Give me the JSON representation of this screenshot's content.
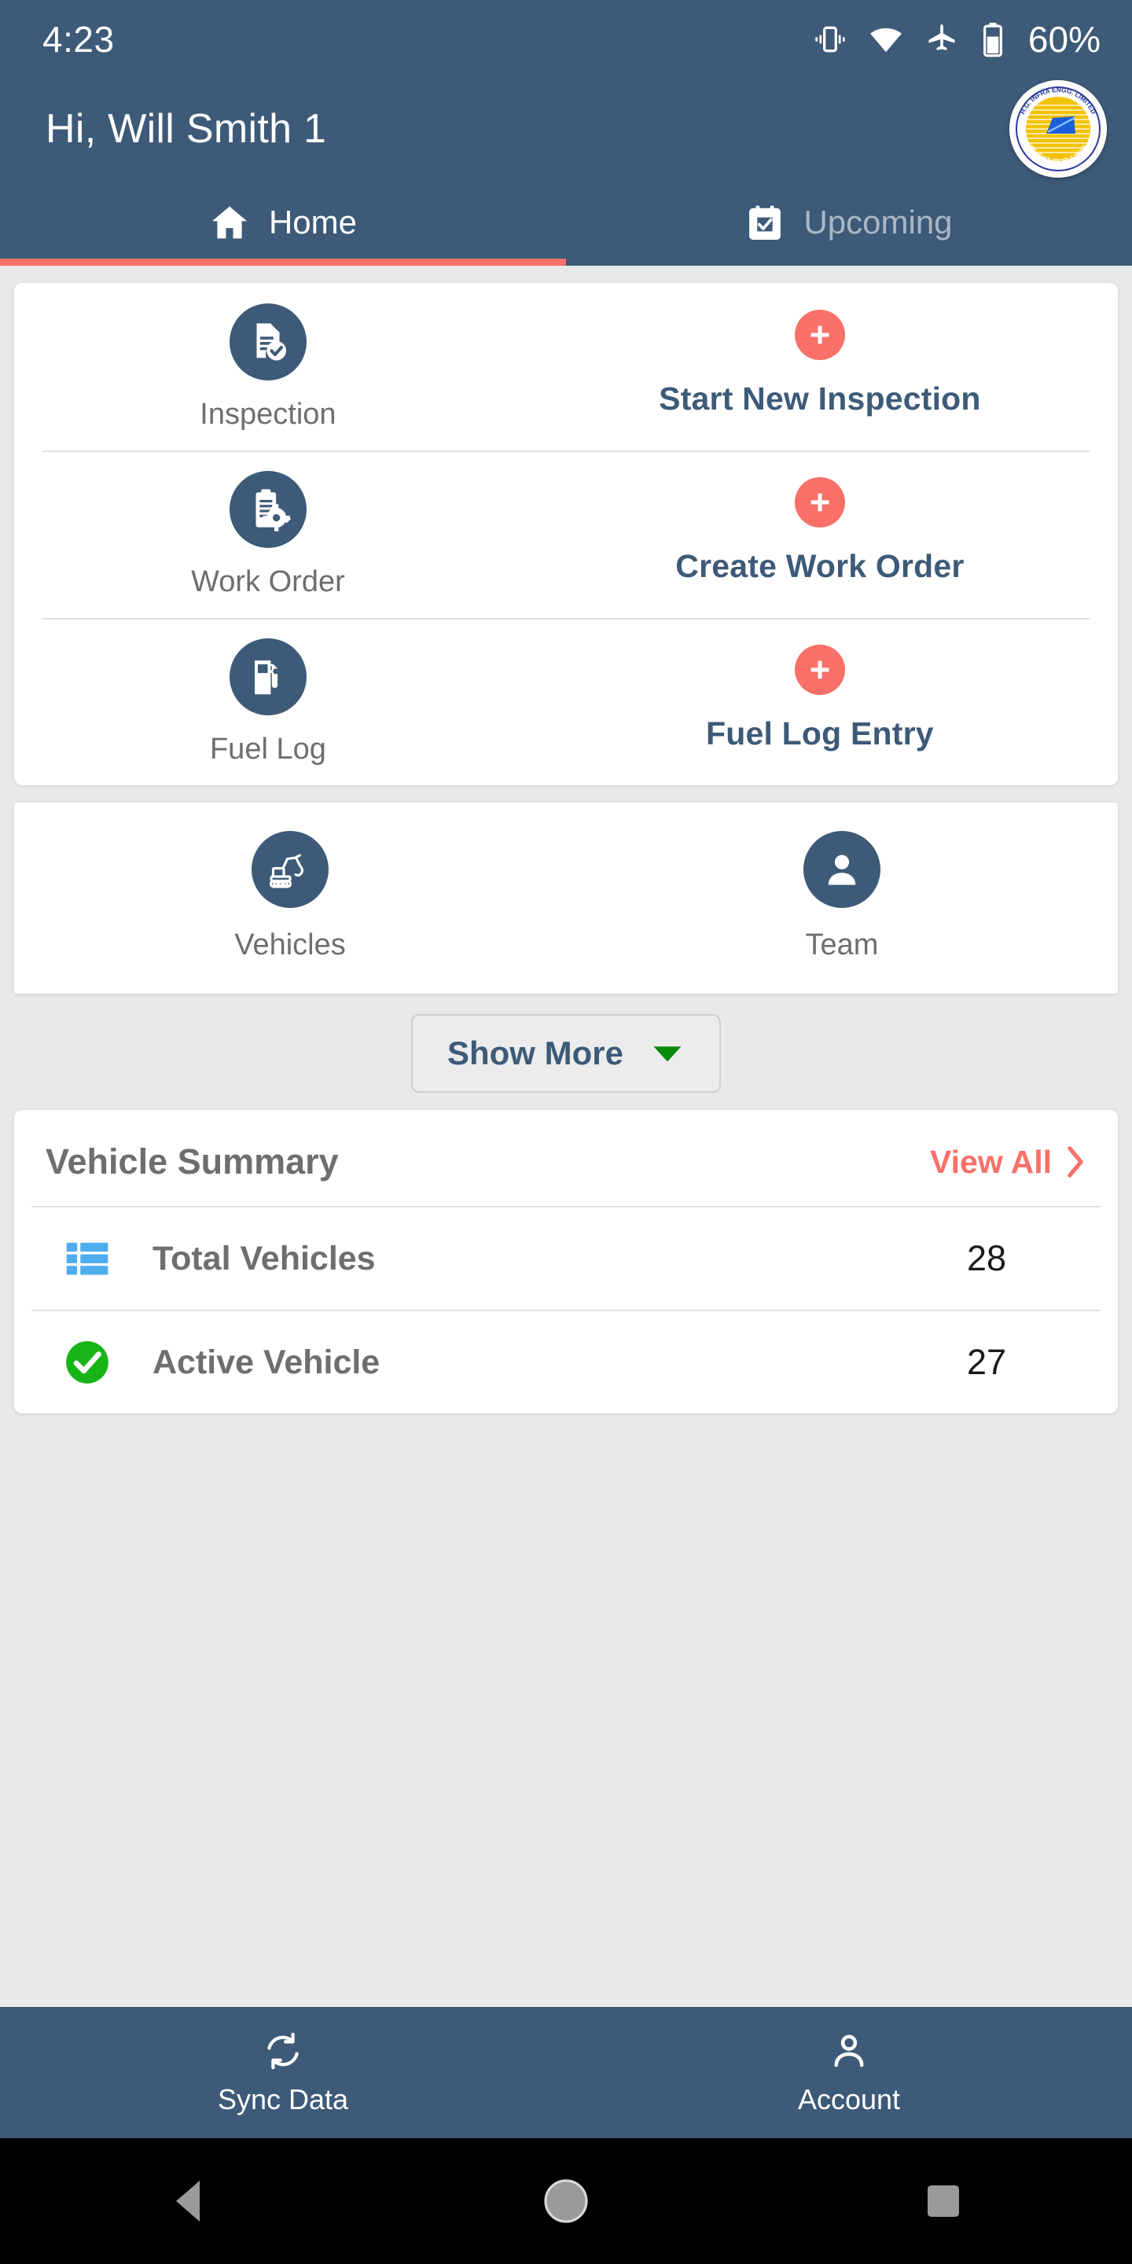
{
  "statusbar": {
    "time": "4:23",
    "battery_percent": "60%",
    "icons": [
      "vibrate-icon",
      "wifi-icon",
      "airplane-icon",
      "battery-icon"
    ]
  },
  "header": {
    "greeting": "Hi, Will Smith 1",
    "logo": {
      "name": "hg-infra-logo",
      "top_text": "H.G. INFRA ENGG. LIMITED",
      "bottom_text": "WE MAKE PEOPLE MOVE"
    },
    "background_color": "#3D5A78",
    "accent_color": "#F97068"
  },
  "tabs": [
    {
      "label": "Home",
      "icon": "home-icon",
      "active": true
    },
    {
      "label": "Upcoming",
      "icon": "calendar-check-icon",
      "active": false
    }
  ],
  "actions": [
    {
      "entity_label": "Inspection",
      "entity_icon": "document-check-icon",
      "action_label": "Start New Inspection",
      "action_icon": "plus-icon"
    },
    {
      "entity_label": "Work Order",
      "entity_icon": "clipboard-gear-icon",
      "action_label": "Create Work Order",
      "action_icon": "plus-icon"
    },
    {
      "entity_label": "Fuel Log",
      "entity_icon": "fuel-pump-icon",
      "action_label": "Fuel Log Entry",
      "action_icon": "plus-icon"
    }
  ],
  "tiles": [
    {
      "label": "Vehicles",
      "icon": "excavator-icon"
    },
    {
      "label": "Team",
      "icon": "person-icon"
    }
  ],
  "show_more": {
    "label": "Show More",
    "icon": "chevron-down-icon",
    "icon_color": "#0A8A0A"
  },
  "vehicle_summary": {
    "title": "Vehicle Summary",
    "view_all_label": "View All",
    "view_all_icon": "chevron-right-icon",
    "rows": [
      {
        "label": "Total Vehicles",
        "value": "28",
        "icon": "list-grid-icon",
        "icon_color": "#4FADEF"
      },
      {
        "label": "Active Vehicle",
        "value": "27",
        "icon": "check-circle-icon",
        "icon_color": "#17B417"
      }
    ]
  },
  "bottom_nav": [
    {
      "label": "Sync Data",
      "icon": "sync-icon"
    },
    {
      "label": "Account",
      "icon": "account-icon"
    }
  ],
  "android_nav": [
    {
      "name": "back-button",
      "icon": "triangle-back-icon"
    },
    {
      "name": "home-button",
      "icon": "circle-home-icon"
    },
    {
      "name": "recents-button",
      "icon": "square-recents-icon"
    }
  ]
}
